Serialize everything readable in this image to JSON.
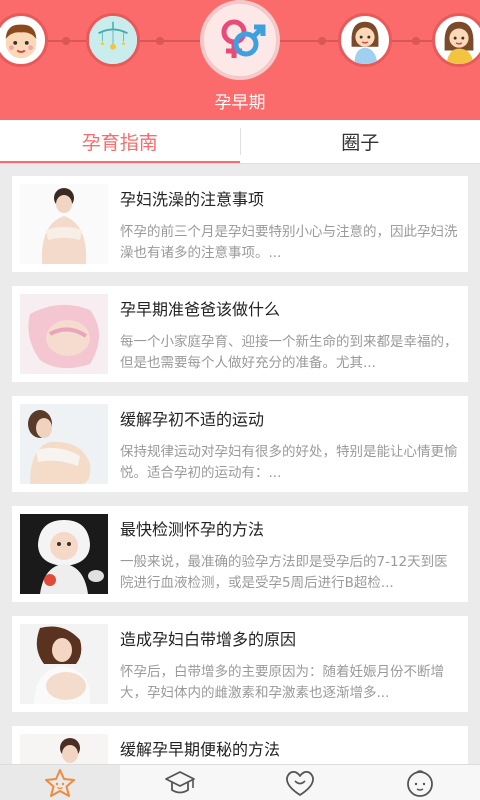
{
  "header": {
    "stage_label": "孕早期",
    "stages": [
      {
        "icon": "baby-boy-face-icon"
      },
      {
        "icon": "crib-mobile-icon"
      },
      {
        "icon": "gender-symbol-icon",
        "active": true
      },
      {
        "icon": "pregnant-woman-icon"
      },
      {
        "icon": "mother-face-icon"
      }
    ]
  },
  "tabs": [
    {
      "label": "孕育指南",
      "active": true
    },
    {
      "label": "圈子",
      "active": false
    }
  ],
  "articles": [
    {
      "title": "孕妇洗澡的注意事项",
      "desc": "怀孕的前三个月是孕妇要特别小心与注意的，因此孕妇洗澡也有诸多的注意事项。..."
    },
    {
      "title": "孕早期准爸爸该做什么",
      "desc": "每一个小家庭孕育、迎接一个新生命的到来都是幸福的，但是也需要每个人做好充分的准备。尤其..."
    },
    {
      "title": "缓解孕初不适的运动",
      "desc": "保持规律运动对孕妇有很多的好处，特别是能让心情更愉悦。适合孕初的运动有：..."
    },
    {
      "title": "最快检测怀孕的方法",
      "desc": "一般来说，最准确的验孕方法即是受孕后的7-12天到医院进行血液检测，或是受孕5周后进行B超检..."
    },
    {
      "title": "造成孕妇白带增多的原因",
      "desc": "怀孕后，白带增多的主要原因为：随着妊娠月份不断增大，孕妇体内的雌激素和孕激素也逐渐增多..."
    },
    {
      "title": "缓解孕早期便秘的方法",
      "desc": ""
    }
  ],
  "bottom_nav": [
    {
      "icon": "star-face-icon",
      "active": true
    },
    {
      "icon": "graduation-cap-icon",
      "active": false
    },
    {
      "icon": "heart-smile-icon",
      "active": false
    },
    {
      "icon": "baby-face-icon",
      "active": false
    }
  ],
  "colors": {
    "accent": "#fb6b6b",
    "card_bg": "#ffffff",
    "page_bg": "#ebebeb"
  }
}
